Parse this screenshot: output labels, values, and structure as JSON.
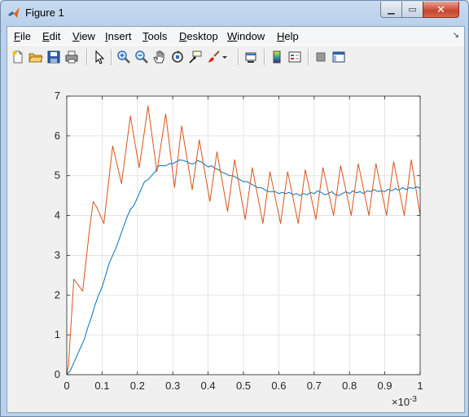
{
  "window": {
    "title": "Figure 1"
  },
  "menu": {
    "items": [
      {
        "key": "F",
        "rest": "ile"
      },
      {
        "key": "E",
        "rest": "dit"
      },
      {
        "key": "V",
        "rest": "iew"
      },
      {
        "key": "I",
        "rest": "nsert"
      },
      {
        "key": "T",
        "rest": "ools"
      },
      {
        "key": "D",
        "rest": "esktop"
      },
      {
        "key": "W",
        "rest": "indow"
      },
      {
        "key": "H",
        "rest": "elp"
      }
    ],
    "overflow_icon": "dock-arrow-icon"
  },
  "toolbar": {
    "icons": [
      "new-figure-icon",
      "open-file-icon",
      "save-icon",
      "print-icon",
      "edit-plot-arrow-icon",
      "zoom-in-icon",
      "zoom-out-icon",
      "pan-hand-icon",
      "rotate-3d-icon",
      "data-cursor-icon",
      "brush-icon",
      "brush-dropdown-icon",
      "link-plot-icon",
      "colorbar-icon",
      "legend-icon",
      "hide-plot-tools-icon",
      "show-plot-tools-icon"
    ]
  },
  "chart_data": {
    "type": "line",
    "xlim": [
      0,
      1
    ],
    "ylim": [
      0,
      7
    ],
    "x_ticks": [
      "0",
      "0.1",
      "0.2",
      "0.3",
      "0.4",
      "0.5",
      "0.6",
      "0.7",
      "0.8",
      "0.9",
      "1"
    ],
    "y_ticks": [
      "0",
      "1",
      "2",
      "3",
      "4",
      "5",
      "6",
      "7"
    ],
    "x_exponent_base": "×10",
    "x_exponent_power": "-3",
    "grid": true,
    "series": [
      {
        "color": "#0072bd",
        "x": [
          0,
          0.01,
          0.02,
          0.03,
          0.04,
          0.05,
          0.06,
          0.07,
          0.08,
          0.09,
          0.1,
          0.11,
          0.12,
          0.13,
          0.14,
          0.15,
          0.16,
          0.17,
          0.18,
          0.19,
          0.2,
          0.21,
          0.22,
          0.23,
          0.24,
          0.25,
          0.26,
          0.27,
          0.28,
          0.29,
          0.3,
          0.31,
          0.32,
          0.33,
          0.34,
          0.35,
          0.36,
          0.37,
          0.38,
          0.39,
          0.4,
          0.41,
          0.42,
          0.43,
          0.44,
          0.45,
          0.46,
          0.47,
          0.48,
          0.49,
          0.5,
          0.51,
          0.52,
          0.53,
          0.54,
          0.55,
          0.56,
          0.57,
          0.58,
          0.59,
          0.6,
          0.61,
          0.62,
          0.63,
          0.64,
          0.65,
          0.66,
          0.67,
          0.68,
          0.69,
          0.7,
          0.71,
          0.72,
          0.73,
          0.74,
          0.75,
          0.76,
          0.77,
          0.78,
          0.79,
          0.8,
          0.81,
          0.82,
          0.83,
          0.84,
          0.85,
          0.86,
          0.87,
          0.88,
          0.89,
          0.9,
          0.91,
          0.92,
          0.93,
          0.94,
          0.95,
          0.96,
          0.97,
          0.98,
          0.99,
          1.0
        ],
        "y": [
          0,
          0.1,
          0.3,
          0.5,
          0.7,
          0.9,
          1.2,
          1.45,
          1.75,
          2.0,
          2.2,
          2.5,
          2.8,
          3.0,
          3.2,
          3.45,
          3.7,
          3.95,
          4.15,
          4.25,
          4.45,
          4.65,
          4.85,
          4.9,
          5.0,
          5.1,
          5.25,
          5.25,
          5.25,
          5.3,
          5.3,
          5.35,
          5.4,
          5.38,
          5.35,
          5.3,
          5.3,
          5.38,
          5.35,
          5.28,
          5.22,
          5.25,
          5.18,
          5.15,
          5.08,
          5.05,
          5.0,
          5.0,
          4.95,
          4.9,
          4.85,
          4.85,
          4.8,
          4.75,
          4.7,
          4.7,
          4.65,
          4.6,
          4.6,
          4.6,
          4.55,
          4.58,
          4.55,
          4.58,
          4.52,
          4.55,
          4.5,
          4.55,
          4.52,
          4.58,
          4.55,
          4.62,
          4.58,
          4.52,
          4.55,
          4.6,
          4.52,
          4.5,
          4.55,
          4.6,
          4.55,
          4.62,
          4.57,
          4.6,
          4.55,
          4.62,
          4.6,
          4.65,
          4.6,
          4.62,
          4.6,
          4.66,
          4.62,
          4.68,
          4.63,
          4.7,
          4.65,
          4.7,
          4.68,
          4.72,
          4.68
        ]
      },
      {
        "color": "#d95319",
        "x": [
          0,
          0.005,
          0.02,
          0.045,
          0.065,
          0.075,
          0.085,
          0.095,
          0.105,
          0.13,
          0.155,
          0.18,
          0.205,
          0.23,
          0.255,
          0.28,
          0.305,
          0.325,
          0.355,
          0.375,
          0.405,
          0.425,
          0.455,
          0.475,
          0.505,
          0.525,
          0.555,
          0.575,
          0.605,
          0.625,
          0.655,
          0.675,
          0.705,
          0.725,
          0.755,
          0.775,
          0.805,
          0.825,
          0.855,
          0.875,
          0.905,
          0.925,
          0.955,
          0.975,
          1.0
        ],
        "y": [
          0,
          0.25,
          2.4,
          2.1,
          3.7,
          4.35,
          4.2,
          4.0,
          3.8,
          5.75,
          4.8,
          6.5,
          5.2,
          6.75,
          5.1,
          6.55,
          4.7,
          6.25,
          4.65,
          5.9,
          4.35,
          5.6,
          4.1,
          5.4,
          3.9,
          5.2,
          3.8,
          5.1,
          3.8,
          5.1,
          3.8,
          5.15,
          3.9,
          5.2,
          4.0,
          5.25,
          4.0,
          5.3,
          4.0,
          5.3,
          4.0,
          5.35,
          4.0,
          5.4,
          4.0
        ]
      }
    ]
  }
}
